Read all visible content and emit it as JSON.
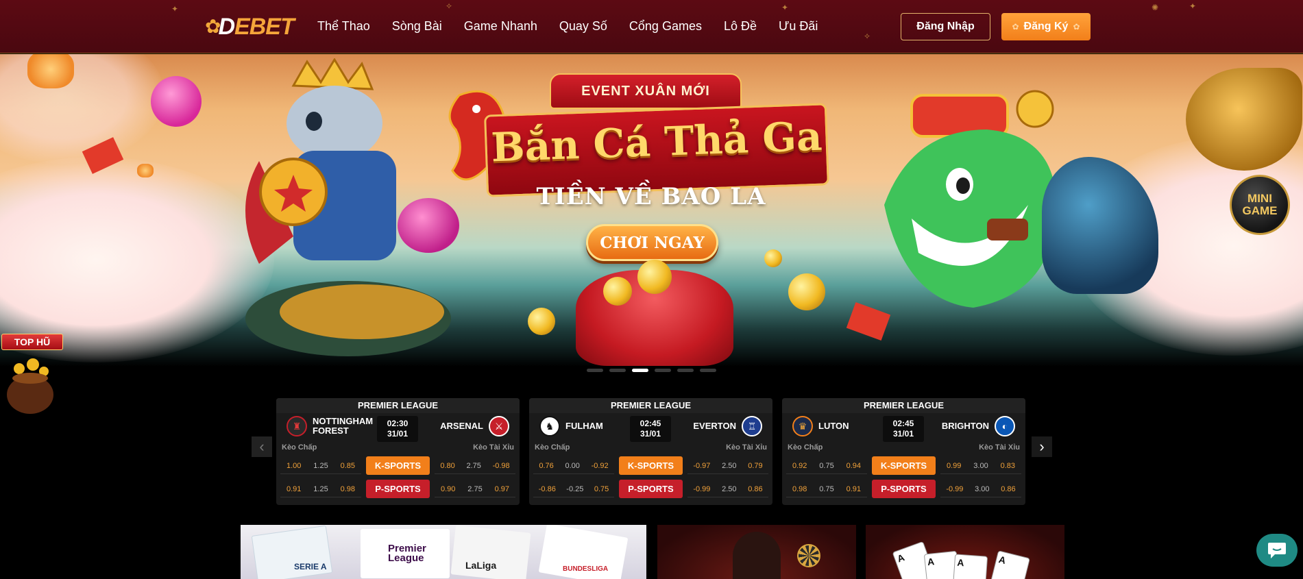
{
  "header": {
    "logo_prefix": "D",
    "logo_rest": "EBET",
    "nav": [
      "Thể Thao",
      "Sòng Bài",
      "Game Nhanh",
      "Quay Số",
      "Cổng Games",
      "Lô Đề",
      "Ưu Đãi"
    ],
    "login_label": "Đăng Nhập",
    "register_label": "Đăng Ký"
  },
  "banner": {
    "event_label": "EVENT XUÂN MỚI",
    "title": "Bắn Cá Thả Ga",
    "subtitle": "TIỀN VỀ BAO LA",
    "cta_label": "CHƠI NGAY",
    "mini_game_line1": "MINI",
    "mini_game_line2": "GAME",
    "top_hu_label": "TOP HŨ",
    "slide_count": 6,
    "active_slide": 2
  },
  "matches": [
    {
      "league": "PREMIER LEAGUE",
      "home": "NOTTINGHAM FOREST",
      "away": "ARSENAL",
      "time": "02:30",
      "date": "31/01",
      "keo_chap": "Kèo Chấp",
      "keo_taixiu": "Kèo Tài Xỉu",
      "k_left": [
        "1.00",
        "1.25",
        "0.85"
      ],
      "k_right": [
        "0.80",
        "2.75",
        "-0.98"
      ],
      "p_left": [
        "0.91",
        "1.25",
        "0.98"
      ],
      "p_right": [
        "0.90",
        "2.75",
        "0.97"
      ],
      "k_label": "K-SPORTS",
      "p_label": "P-SPORTS"
    },
    {
      "league": "PREMIER LEAGUE",
      "home": "FULHAM",
      "away": "EVERTON",
      "time": "02:45",
      "date": "31/01",
      "keo_chap": "Kèo Chấp",
      "keo_taixiu": "Kèo Tài Xỉu",
      "k_left": [
        "0.76",
        "0.00",
        "-0.92"
      ],
      "k_right": [
        "-0.97",
        "2.50",
        "0.79"
      ],
      "p_left": [
        "-0.86",
        "-0.25",
        "0.75"
      ],
      "p_right": [
        "-0.99",
        "2.50",
        "0.86"
      ],
      "k_label": "K-SPORTS",
      "p_label": "P-SPORTS"
    },
    {
      "league": "PREMIER LEAGUE",
      "home": "LUTON",
      "away": "BRIGHTON",
      "time": "02:45",
      "date": "31/01",
      "keo_chap": "Kèo Chấp",
      "keo_taixiu": "Kèo Tài Xỉu",
      "k_left": [
        "0.92",
        "0.75",
        "0.94"
      ],
      "k_right": [
        "0.99",
        "3.00",
        "0.83"
      ],
      "p_left": [
        "0.98",
        "0.75",
        "0.91"
      ],
      "p_right": [
        "-0.99",
        "3.00",
        "0.86"
      ],
      "k_label": "K-SPORTS",
      "p_label": "P-SPORTS"
    }
  ],
  "tiles": {
    "leagues": [
      "SERIE A",
      "Premier League",
      "LaLiga",
      "BUNDESLIGA"
    ]
  },
  "colors": {
    "header_bg": "#4a0810",
    "accent_orange": "#f27f1a",
    "accent_red": "#c61f2a",
    "gold": "#e3b36a"
  },
  "icons": {
    "prev": "chevron-left-icon",
    "next": "chevron-right-icon",
    "chat": "chat-bubble-icon"
  }
}
